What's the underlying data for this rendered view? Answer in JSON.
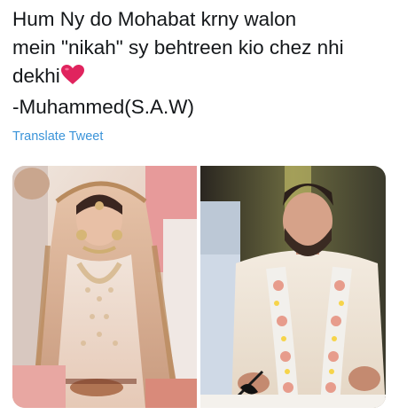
{
  "tweet": {
    "lines": [
      "Hum Ny do Mohabat krny walon",
      "mein \"nikah\" sy behtreen kio chez nhi",
      "dekhi",
      "-Muhammed(S.A.W)"
    ],
    "emoji": "red-heart-icon",
    "translate_label": "Translate Tweet"
  },
  "media": {
    "photos": [
      {
        "name": "bride-photo",
        "subject": "bride"
      },
      {
        "name": "groom-photo",
        "subject": "groom"
      }
    ]
  },
  "colors": {
    "text": "#14171a",
    "link": "#3b94d9",
    "heart": "#e0245e"
  }
}
